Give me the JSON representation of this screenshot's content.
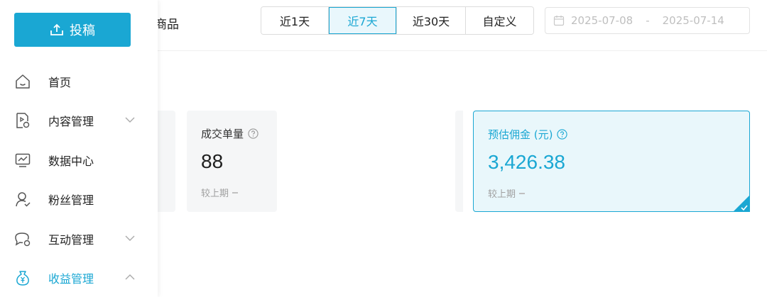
{
  "header": {
    "peek_title": "商品",
    "range_options": [
      {
        "label": "近1天",
        "active": false
      },
      {
        "label": "近7天",
        "active": true
      },
      {
        "label": "近30天",
        "active": false
      },
      {
        "label": "自定义",
        "active": false
      }
    ],
    "date_start": "2025-07-08",
    "date_separator": "-",
    "date_end": "2025-07-14"
  },
  "sidebar": {
    "upload_label": "投稿",
    "items": [
      {
        "label": "首页",
        "icon": "home-icon",
        "expandable": false,
        "active": false
      },
      {
        "label": "内容管理",
        "icon": "content-icon",
        "expandable": true,
        "expanded": false,
        "active": false
      },
      {
        "label": "数据中心",
        "icon": "data-chart-icon",
        "expandable": false,
        "active": false
      },
      {
        "label": "粉丝管理",
        "icon": "fans-icon",
        "expandable": false,
        "active": false
      },
      {
        "label": "互动管理",
        "icon": "chat-icon",
        "expandable": true,
        "expanded": false,
        "active": false
      },
      {
        "label": "收益管理",
        "icon": "money-bag-icon",
        "expandable": true,
        "expanded": true,
        "active": true
      }
    ]
  },
  "metrics": [
    {
      "title": "成交单量",
      "value": "88",
      "compare_label": "较上期",
      "selected": false
    },
    {
      "title": "预估佣金 (元)",
      "value": "3,426.38",
      "compare_label": "较上期",
      "selected": true
    }
  ],
  "colors": {
    "accent": "#1aa7d3",
    "card_bg": "#f5f6f7",
    "selected_bg": "#e9f7fb"
  }
}
